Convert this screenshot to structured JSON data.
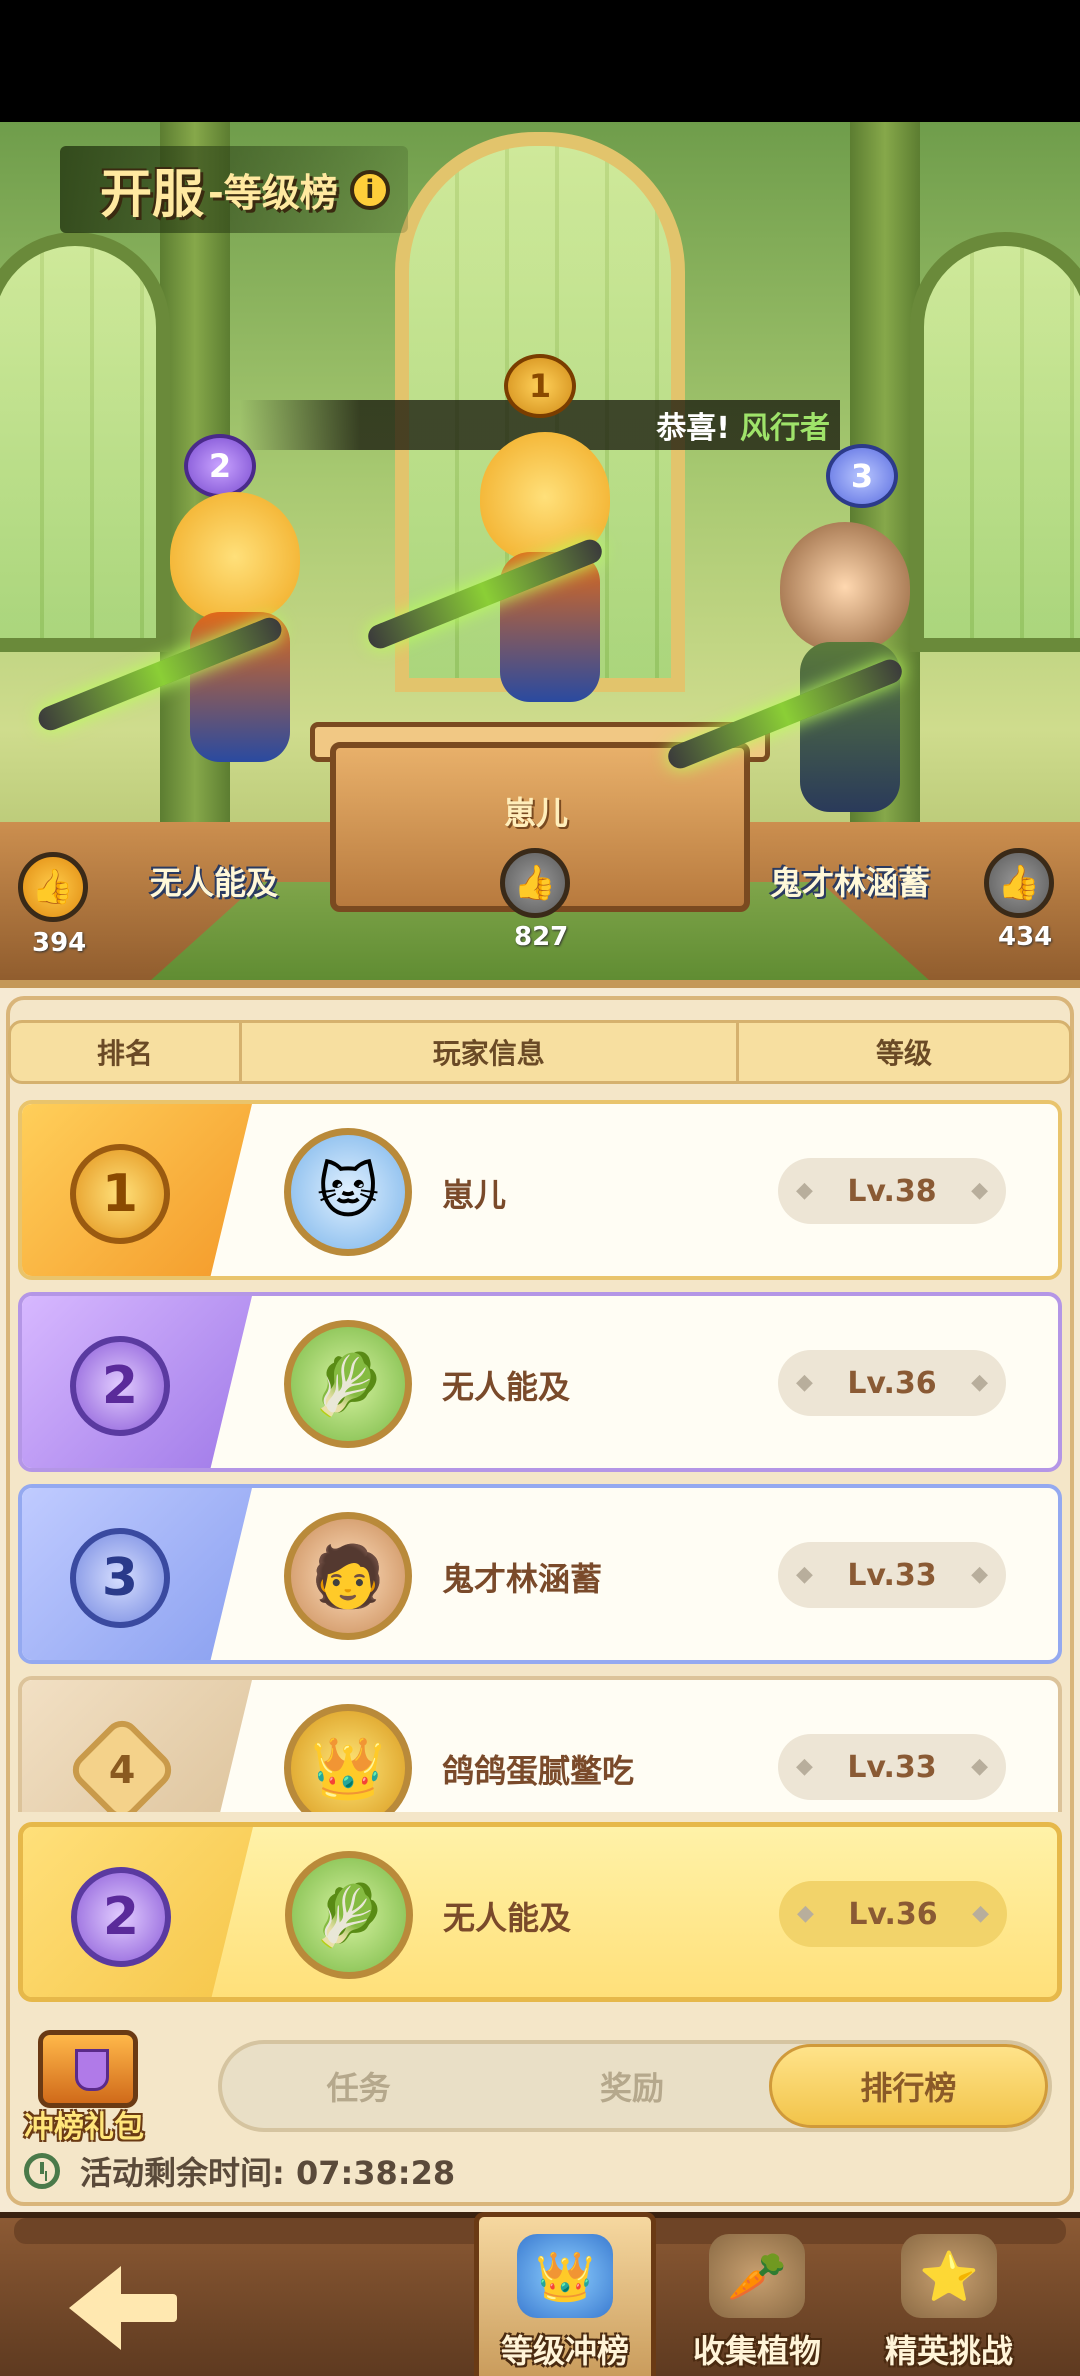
{
  "header": {
    "title_main": "开服",
    "title_sub": "-等级榜",
    "info_glyph": "i"
  },
  "congrats": {
    "prefix": "恭喜!",
    "name": "风行者"
  },
  "podium": {
    "first": {
      "rank": "1",
      "name": "崽儿",
      "likes": "827"
    },
    "second": {
      "rank": "2",
      "name": "无人能及",
      "likes": "394"
    },
    "third": {
      "rank": "3",
      "name": "鬼才林涵蓄",
      "likes": "434"
    }
  },
  "table": {
    "headers": [
      "排名",
      "玩家信息",
      "等级"
    ],
    "rows": [
      {
        "rank": "1",
        "name": "崽儿",
        "level": "Lv.38",
        "avatar_icon": "cat-spirit-icon"
      },
      {
        "rank": "2",
        "name": "无人能及",
        "level": "Lv.36",
        "avatar_icon": "plant-icon"
      },
      {
        "rank": "3",
        "name": "鬼才林涵蓄",
        "level": "Lv.33",
        "avatar_icon": "boy-icon"
      },
      {
        "rank": "4",
        "name": "鸽鸽蛋腻鳖吃",
        "level": "Lv.33",
        "avatar_icon": "golden-warrior-icon"
      }
    ],
    "self_row": {
      "rank": "2",
      "name": "无人能及",
      "level": "Lv.36",
      "avatar_icon": "plant-icon"
    }
  },
  "gift": {
    "label": "冲榜礼包"
  },
  "tabs": [
    {
      "label": "任务",
      "active": false
    },
    {
      "label": "奖励",
      "active": false
    },
    {
      "label": "排行榜",
      "active": true
    }
  ],
  "timer": {
    "text": "活动剩余时间: 07:38:28"
  },
  "bottom_nav": [
    {
      "label": "等级冲榜",
      "active": true
    },
    {
      "label": "收集植物",
      "active": false
    },
    {
      "label": "精英挑战",
      "active": false
    }
  ],
  "colors": {
    "accent": "#f2c44a",
    "panel_bg": "#f6ead3",
    "name_text": "#7a4a2a"
  }
}
